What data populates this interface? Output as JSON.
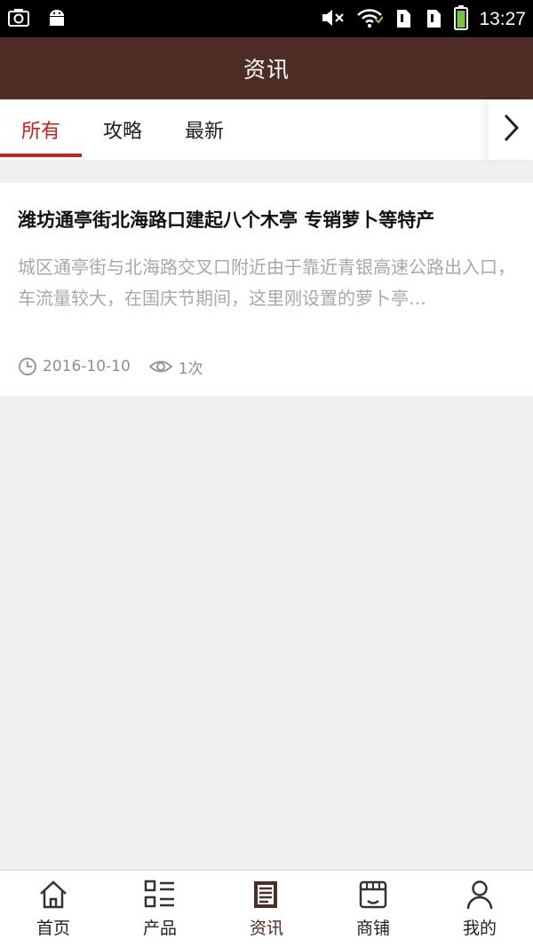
{
  "status_bar": {
    "time": "13:27"
  },
  "header": {
    "title": "资讯"
  },
  "tabs": [
    {
      "label": "所有",
      "active": true
    },
    {
      "label": "攻略",
      "active": false
    },
    {
      "label": "最新",
      "active": false
    }
  ],
  "article": {
    "title": "潍坊通亭街北海路口建起八个木亭 专销萝卜等特产",
    "summary": "城区通亭街与北海路交叉口附近由于靠近青银高速公路出入口，车流量较大，在国庆节期间，这里刚设置的萝卜亭…",
    "date": "2016-10-10",
    "views": "1次"
  },
  "bottom_nav": [
    {
      "label": "首页",
      "icon": "home-icon",
      "active": false
    },
    {
      "label": "产品",
      "icon": "product-list-icon",
      "active": false
    },
    {
      "label": "资讯",
      "icon": "news-icon",
      "active": true
    },
    {
      "label": "商铺",
      "icon": "store-icon",
      "active": false
    },
    {
      "label": "我的",
      "icon": "user-icon",
      "active": false
    }
  ],
  "colors": {
    "header_bg": "#4d2d26",
    "accent_red": "#c81e1e",
    "page_bg": "#f0f0f0"
  }
}
